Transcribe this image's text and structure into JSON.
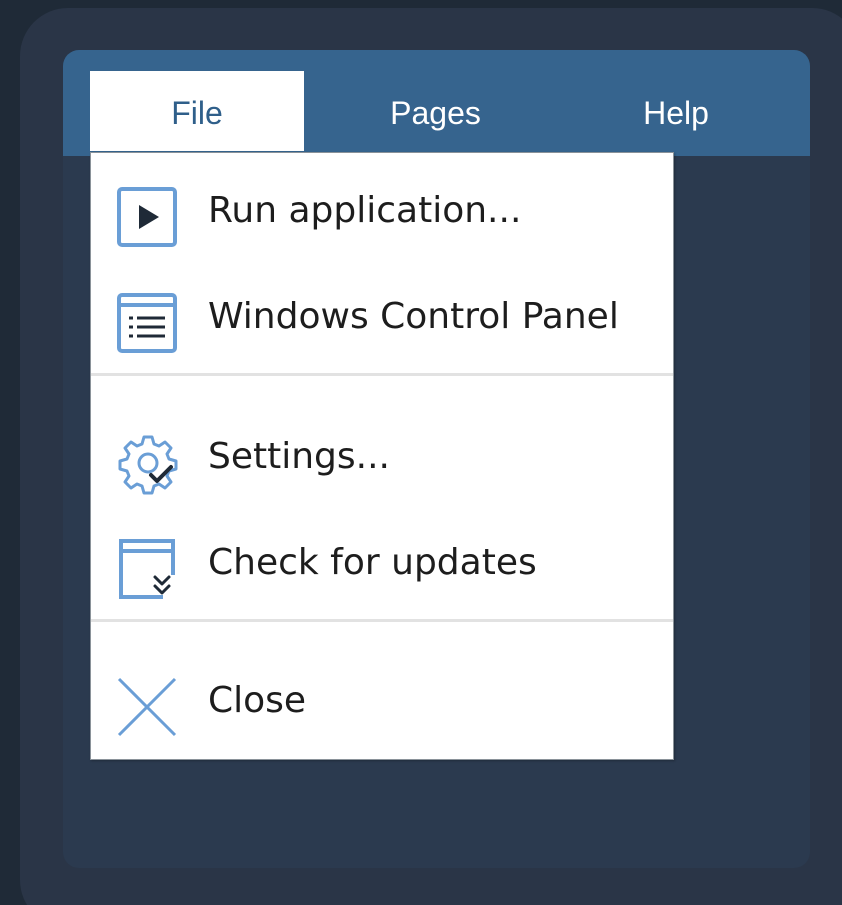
{
  "menubar": {
    "items": [
      {
        "label": "File",
        "active": true
      },
      {
        "label": "Pages",
        "active": false
      },
      {
        "label": "Help",
        "active": false
      }
    ]
  },
  "file_menu": {
    "items": [
      {
        "label": "Run application...",
        "icon": "play-icon"
      },
      {
        "label": "Windows Control Panel",
        "icon": "list-window-icon"
      },
      {
        "label": "Settings...",
        "icon": "gear-check-icon"
      },
      {
        "label": "Check for updates",
        "icon": "update-window-icon"
      },
      {
        "label": "Close",
        "icon": "close-icon"
      }
    ]
  },
  "colors": {
    "menubar_background": "#36648e",
    "icon_accent": "#6a9ed6",
    "background": "#1f2a37"
  }
}
